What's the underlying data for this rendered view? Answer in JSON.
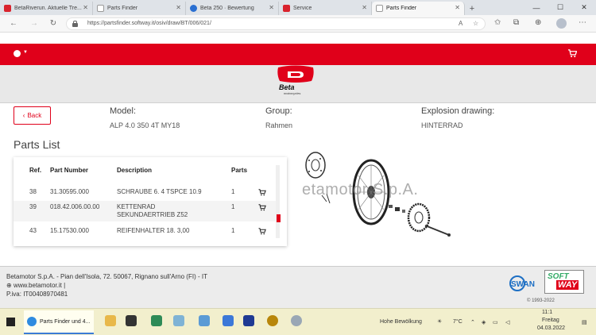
{
  "browser": {
    "tabs": [
      {
        "label": "BetaRiverun. Aktuelle Tre...",
        "icon": "beta-favicon"
      },
      {
        "label": "Parts Finder",
        "icon": "page-favicon"
      },
      {
        "label": "Beta 250 · Bewertung",
        "icon": "page-favicon"
      },
      {
        "label": "Service",
        "icon": "beta-favicon"
      },
      {
        "label": "Parts Finder",
        "icon": "page-favicon"
      }
    ],
    "new_tab": "+",
    "url": "https://partsfinder.softway.it/osiv/draw/BT/006/021/"
  },
  "site": {
    "accent": "#e0001a",
    "brand_word": "Beta",
    "brand_sub": "motorcycles"
  },
  "info": {
    "back_label": "Back",
    "model_label": "Model:",
    "model_value": "ALP 4.0 350 4T MY18",
    "group_label": "Group:",
    "group_value": "Rahmen",
    "drawing_label": "Explosion drawing:",
    "drawing_value": "HINTERRAD"
  },
  "parts": {
    "title": "Parts List",
    "headers": {
      "ref": "Ref.",
      "part": "Part Number",
      "desc": "Description",
      "qty": "Parts"
    },
    "rows": [
      {
        "ref": "38",
        "part": "31.30595.000",
        "desc": "SCHRAUBE 6. 4 TSPCE 10.9",
        "desc2": "",
        "qty": "1"
      },
      {
        "ref": "39",
        "part": "018.42.006.00.00",
        "desc": "KETTENRAD",
        "desc2": "SEKUNDAERTRIEB Z52",
        "qty": "1"
      },
      {
        "ref": "43",
        "part": "15.17530.000",
        "desc": "REIFENHALTER 18. 3,00",
        "desc2": "",
        "qty": "1"
      }
    ]
  },
  "drawing": {
    "watermark": "etamotor S.p.A."
  },
  "footer": {
    "line1": "Betamotor S.p.A. - Pian dell'Isola, 72. 50067, Rignano sull'Arno (FI) - IT",
    "line2": "www.betamotor.it |",
    "line3": "P.iva: IT00408970481",
    "copyright": "© 1993-2022",
    "swan": "SWAN",
    "softway_top": "SOFT",
    "softway_bottom": "WAY"
  },
  "taskbar": {
    "active_window": "Parts Finder und 4...",
    "weather_label": "Hohe Bewölkung",
    "temperature": "7°C",
    "time": "11:1",
    "day": "Freitag",
    "date": "04.03.2022"
  }
}
